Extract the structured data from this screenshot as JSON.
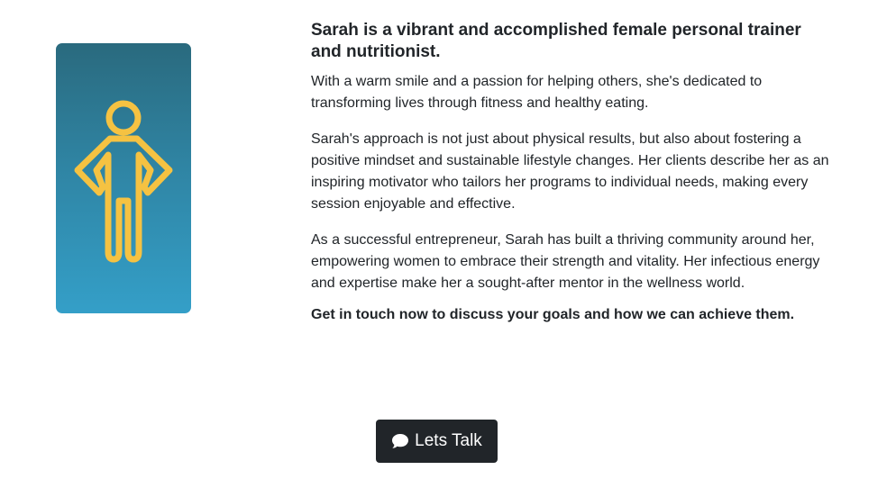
{
  "profile": {
    "icon": "person-standing-icon",
    "accent_color": "#f5c242",
    "gradient": [
      "#2a6a7e",
      "#349fc8"
    ]
  },
  "bio": {
    "headline": "Sarah is a vibrant and accomplished female personal trainer and nutritionist.",
    "paragraphs": [
      "With a warm smile and a passion for helping others, she's dedicated to transforming lives through fitness and healthy eating.",
      "Sarah's approach is not just about physical results, but also about fostering a positive mindset and sustainable lifestyle changes. Her clients describe her as an inspiring motivator who tailors her programs to individual needs, making every session enjoyable and effective.",
      "As a successful entrepreneur, Sarah has built a thriving community around her, empowering women to embrace their strength and vitality. Her infectious energy and expertise make her a sought-after mentor in the wellness world."
    ],
    "cta_text": "Get in touch now to discuss your goals and how we can achieve them."
  },
  "cta_button": {
    "label": "Lets Talk",
    "icon": "chat-bubble-icon",
    "background": "#212529"
  }
}
